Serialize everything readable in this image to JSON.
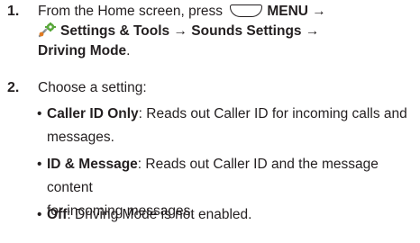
{
  "steps": [
    {
      "number": "1.",
      "line1_pre": "From the Home screen, press",
      "menu_key_label": "MENU",
      "arrow": "→",
      "settings_tools": "Settings & Tools",
      "sounds_settings": "Sounds Settings",
      "driving_mode": "Driving Mode",
      "period": "."
    },
    {
      "number": "2.",
      "text": "Choose a setting:"
    }
  ],
  "options": [
    {
      "name": "Caller ID Only",
      "desc_line1": ": Reads out Caller ID  for incoming calls and",
      "desc_line2": "messages."
    },
    {
      "name": "ID & Message",
      "desc_line1": ": Reads out Caller ID and the message content",
      "desc_line2": "for incoming messages."
    },
    {
      "name": "Off",
      "desc_line1": ": Driving Mode is not enabled."
    }
  ],
  "icons": {
    "menu_key": "menu-key-icon",
    "settings": "settings-tools-icon",
    "bullet": "•"
  },
  "colors": {
    "text": "#231f20",
    "icon_green": "#5aa83c",
    "icon_orange": "#e07a22"
  }
}
